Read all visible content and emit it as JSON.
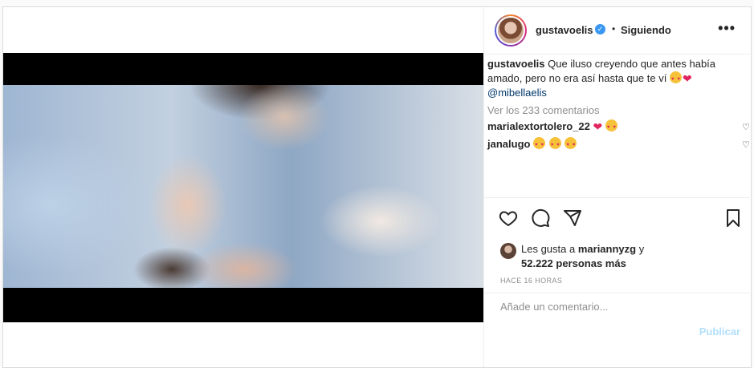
{
  "post": {
    "author": {
      "username": "gustavoelis",
      "verified_mark": "✓",
      "separator": "•",
      "follow_state": "Siguiendo",
      "more_label": "•••"
    },
    "caption": {
      "username": "gustavoelis",
      "text": "Que iluso creyendo que antes había amado, pero no era así hasta que te ví",
      "mention": "@mibellaelis"
    },
    "view_all_comments": "Ver los 233 comentarios",
    "comments": [
      {
        "username": "marialextortolero_22",
        "emojis": [
          "heart",
          "heart-eyes"
        ]
      },
      {
        "username": "janalugo",
        "emojis": [
          "heart-eyes",
          "heart-eyes",
          "heart-eyes"
        ]
      }
    ],
    "likes": {
      "prefix": "Les gusta a",
      "liked_by": "mariannyzg",
      "conjunction": "y",
      "others": "52.222 personas más"
    },
    "timestamp": "HACE 16 HORAS",
    "comment_input_placeholder": "Añade un comentario...",
    "publish_label": "Publicar"
  },
  "icons": {
    "like": "heart-outline-icon",
    "comment": "speech-bubble-icon",
    "share": "paper-plane-icon",
    "save": "bookmark-icon"
  },
  "colors": {
    "link": "#00376b",
    "muted": "#8e8e8e",
    "publish_disabled": "#b2dffc",
    "verified": "#3897f0"
  }
}
